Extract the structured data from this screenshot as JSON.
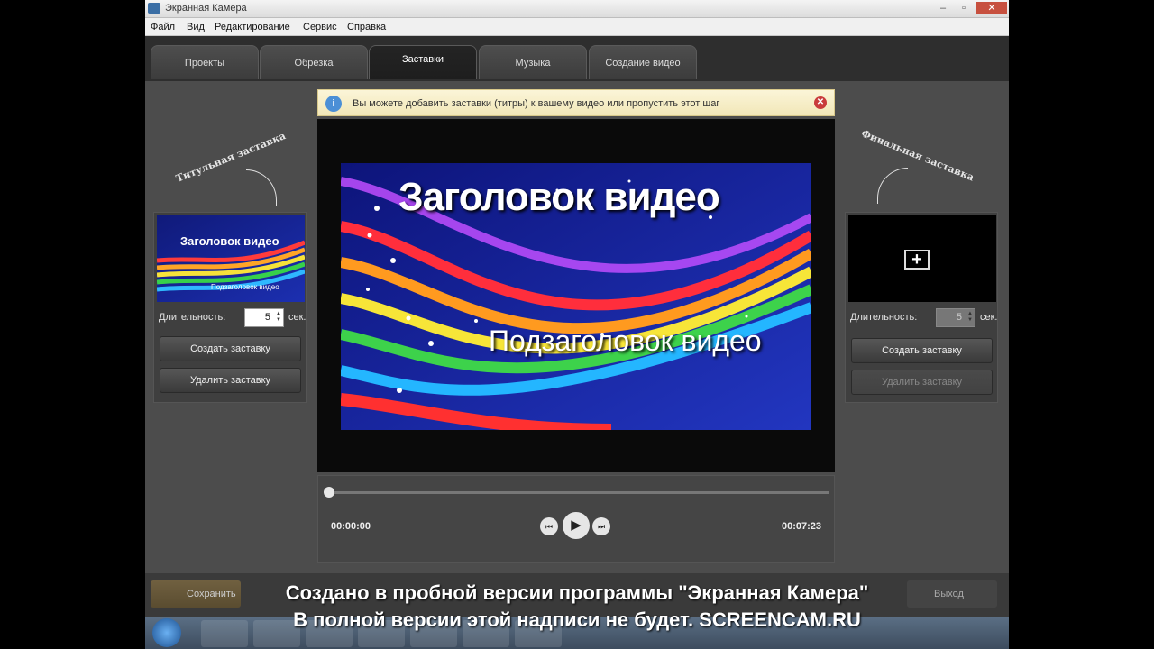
{
  "window": {
    "title": "Экранная Камера",
    "minimize": "–",
    "maximize": "▫",
    "close": "✕"
  },
  "menu": [
    "Файл",
    "Вид",
    "Редактирование",
    "Сервис",
    "Справка"
  ],
  "tabs": [
    "Проекты",
    "Обрезка",
    "Заставки",
    "Музыка",
    "Создание видео"
  ],
  "active_tab": "Заставки",
  "notice": {
    "text": "Вы можете добавить заставки (титры) к вашему видео или пропустить этот шаг",
    "info_icon": "i",
    "close_icon": "✕"
  },
  "left_panel": {
    "label": "Титульная заставка",
    "thumb_title": "Заголовок видео",
    "thumb_sub": "Подзаголовок видео",
    "duration_label": "Длительность:",
    "duration_value": "5",
    "duration_unit": "сек.",
    "create_button": "Создать заставку",
    "delete_button": "Удалить заставку"
  },
  "right_panel": {
    "label": "Финальная заставка",
    "add_icon": "+",
    "duration_label": "Длительность:",
    "duration_value": "5",
    "duration_unit": "сек.",
    "create_button": "Создать заставку",
    "delete_button": "Удалить заставку"
  },
  "preview": {
    "title": "Заголовок видео",
    "subtitle": "Подзаголовок видео"
  },
  "player": {
    "current_time": "00:00:00",
    "total_time": "00:07:23",
    "progress": 0
  },
  "bottom": {
    "save_button": "Сохранить",
    "exit_button": "Выход"
  },
  "watermark": {
    "line1": "Создано в пробной версии программы \"Экранная Камера\"",
    "line2": "В полной версии этой надписи не будет. SCREENCAM.RU"
  }
}
